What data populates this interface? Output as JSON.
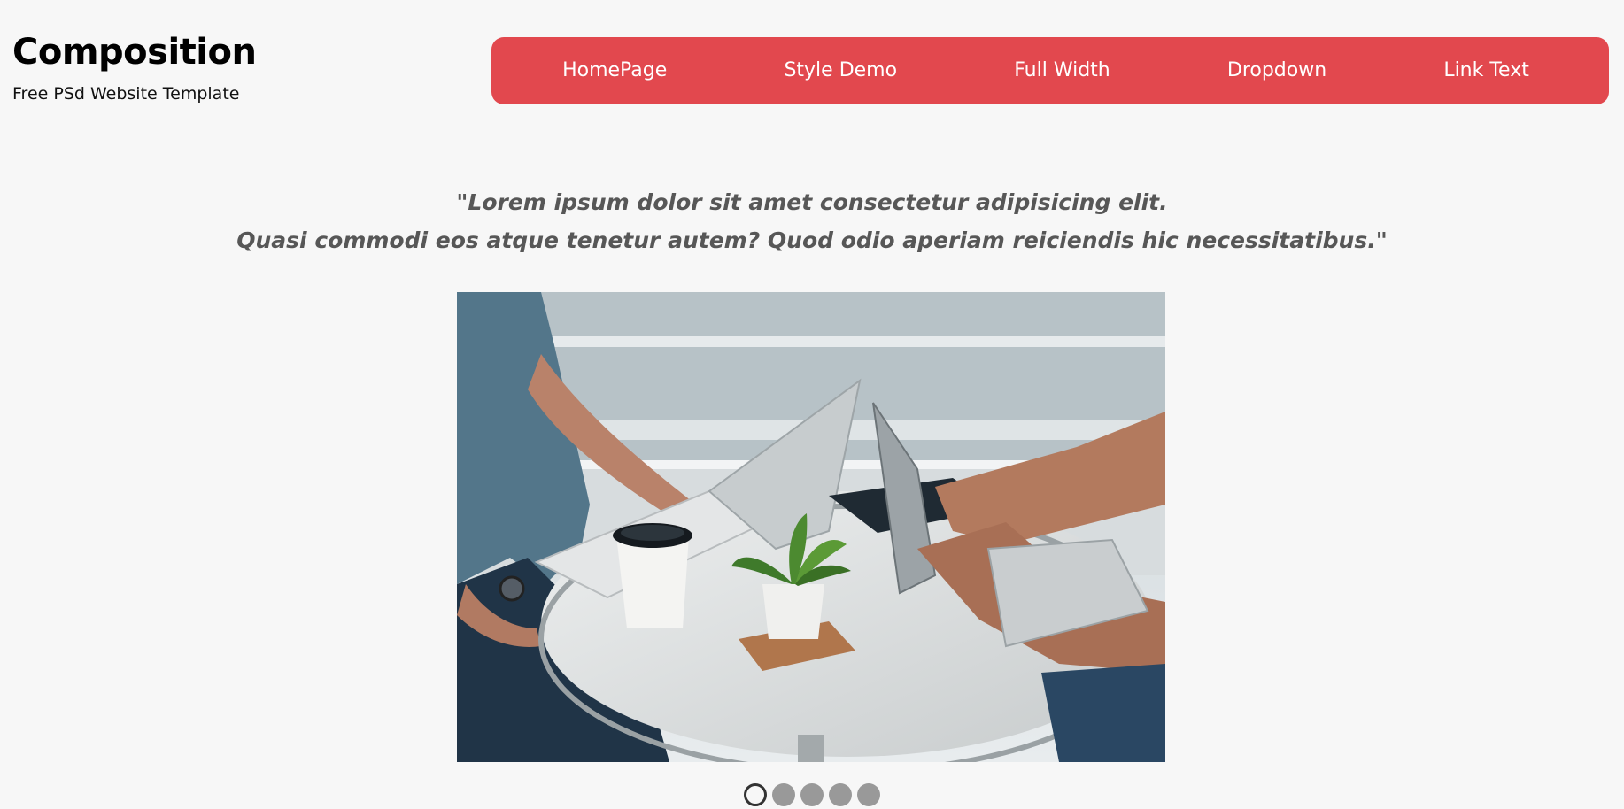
{
  "brand": {
    "title": "Composition",
    "subtitle": "Free PSd Website Template"
  },
  "nav": {
    "accent_color": "#e2484e",
    "items": [
      "HomePage",
      "Style Demo",
      "Full Width",
      "Dropdown",
      "Link Text"
    ]
  },
  "quote": {
    "line1": "\"Lorem ipsum dolor sit amet consectetur adipisicing elit.",
    "line2": "Quasi commodi eos atque tenetur autem? Quod odio aperiam reiciendis hic necessitatibus.\""
  },
  "slider": {
    "image_icon": "photo-two-people-laptops-coffee-table",
    "dot_count": 5,
    "active_index": 0
  }
}
